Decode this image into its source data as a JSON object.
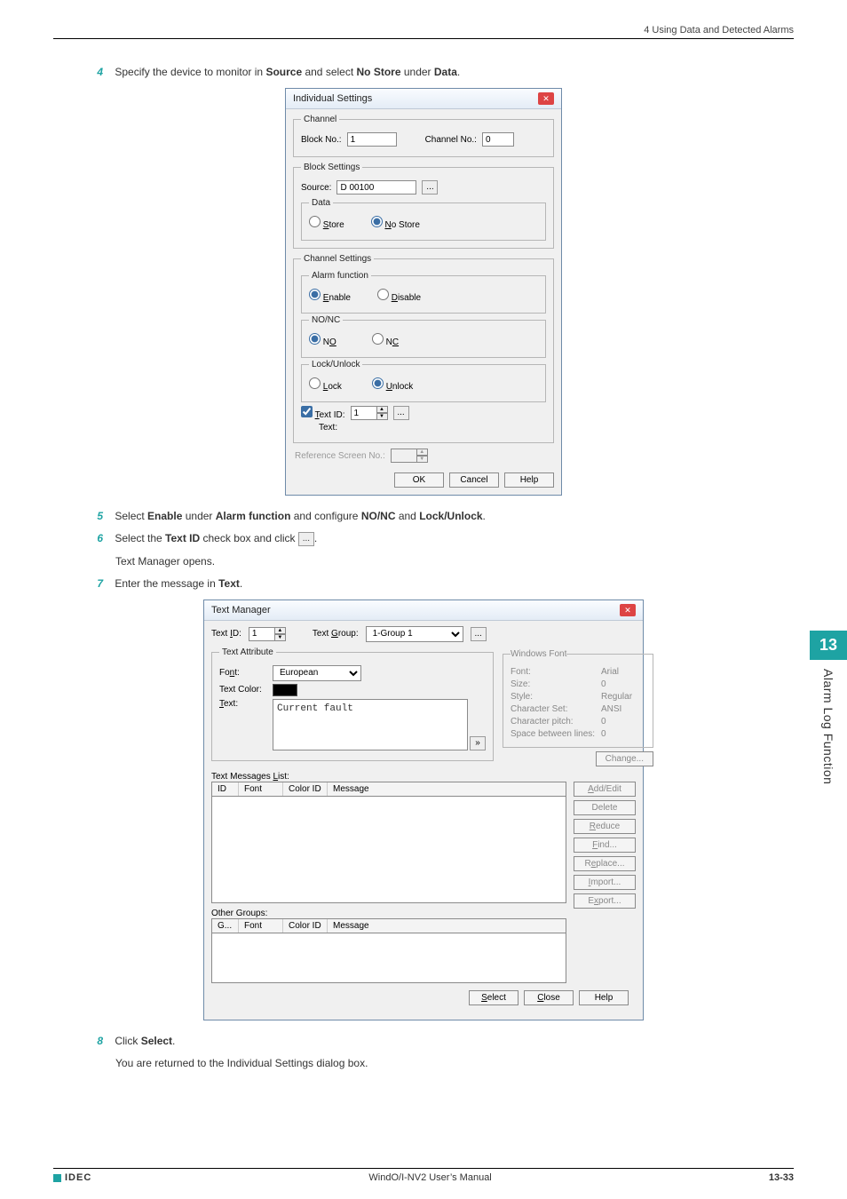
{
  "header": {
    "chapter_title": "4 Using Data and Detected Alarms"
  },
  "steps": {
    "s4": {
      "num": "4",
      "text_pre": "Specify the device to monitor in ",
      "b1": "Source",
      "mid": " and select ",
      "b2": "No Store",
      "mid2": " under ",
      "b3": "Data",
      "tail": "."
    },
    "s5": {
      "num": "5",
      "text_pre": "Select ",
      "b1": "Enable",
      "mid": " under ",
      "b2": "Alarm function",
      "mid2": " and configure ",
      "b3": "NO/NC",
      "mid3": " and ",
      "b4": "Lock/Unlock",
      "tail": "."
    },
    "s6": {
      "num": "6",
      "text_pre": "Select the ",
      "b1": "Text ID",
      "mid": " check box and click ",
      "tail": ".",
      "note": "Text Manager opens."
    },
    "s7": {
      "num": "7",
      "text_pre": "Enter the message in ",
      "b1": "Text",
      "tail": "."
    },
    "s8": {
      "num": "8",
      "text_pre": "Click ",
      "b1": "Select",
      "tail": ".",
      "note": "You are returned to the Individual Settings dialog box."
    }
  },
  "dlg_individual": {
    "title": "Individual Settings",
    "channel": {
      "legend": "Channel",
      "block_no_label": "Block No.:",
      "block_no_value": "1",
      "channel_no_label": "Channel No.:",
      "channel_no_value": "0"
    },
    "block_settings": {
      "legend": "Block Settings",
      "source_label": "Source:",
      "source_value": "D 00100",
      "data": {
        "legend": "Data",
        "store": "Store",
        "no_store": "No Store"
      }
    },
    "channel_settings": {
      "legend": "Channel Settings",
      "alarm": {
        "legend": "Alarm function",
        "enable": "Enable",
        "disable": "Disable"
      },
      "nonc": {
        "legend": "NO/NC",
        "no": "NO",
        "nc": "NC"
      },
      "lock": {
        "legend": "Lock/Unlock",
        "lock": "Lock",
        "unlock": "Unlock"
      },
      "text_id_label": "Text ID:",
      "text_id_value": "1",
      "text_label": "Text:"
    },
    "ref_label": "Reference Screen No.:",
    "buttons": {
      "ok": "OK",
      "cancel": "Cancel",
      "help": "Help"
    }
  },
  "dlg_tm": {
    "title": "Text Manager",
    "text_id_label": "Text ID:",
    "text_id_value": "1",
    "text_group_label": "Text Group:",
    "text_group_value": "1-Group 1",
    "attr": {
      "legend": "Text Attribute",
      "font_label": "Font:",
      "font_value": "European",
      "color_label": "Text Color:",
      "text_label": "Text:",
      "text_value": "Current fault"
    },
    "winfont": {
      "legend": "Windows Font",
      "font": "Font:",
      "font_v": "Arial",
      "size": "Size:",
      "size_v": "0",
      "style": "Style:",
      "style_v": "Regular",
      "charset": "Character Set:",
      "charset_v": "ANSI",
      "pitch": "Character pitch:",
      "pitch_v": "0",
      "space": "Space between lines:",
      "space_v": "0",
      "change": "Change..."
    },
    "list_label": "Text Messages List:",
    "cols": {
      "id": "ID",
      "font": "Font",
      "colorid": "Color ID",
      "message": "Message"
    },
    "other_groups": "Other Groups:",
    "cols2": {
      "g": "G...",
      "font": "Font",
      "colorid": "Color ID",
      "message": "Message"
    },
    "side": {
      "add": "Add/Edit",
      "del": "Delete",
      "reduce": "Reduce",
      "find": "Find...",
      "replace": "Replace...",
      "import": "Import...",
      "export": "Export..."
    },
    "buttons": {
      "select": "Select",
      "close": "Close",
      "help": "Help"
    }
  },
  "sidetab": {
    "num": "13",
    "label": "Alarm Log Function"
  },
  "footer": {
    "brand": "IDEC",
    "center": "WindO/I-NV2 User’s Manual",
    "page": "13-33"
  }
}
